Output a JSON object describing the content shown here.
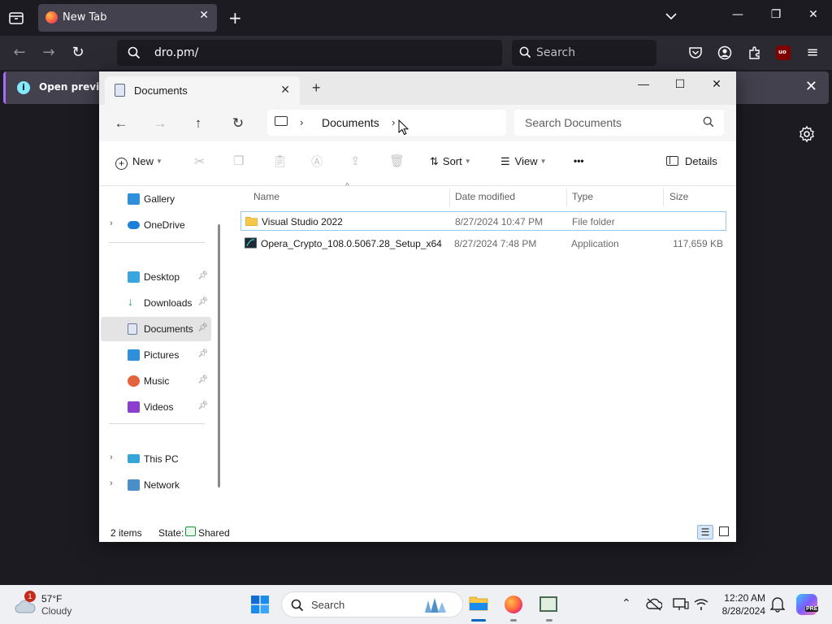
{
  "browser": {
    "tab_title": "New Tab",
    "url": "dro.pm/",
    "search_placeholder": "Search",
    "notification_text": "Open previous"
  },
  "explorer": {
    "tab_title": "Documents",
    "breadcrumb": "Documents",
    "search_placeholder": "Search Documents",
    "commands": {
      "new": "New",
      "sort": "Sort",
      "view": "View",
      "more": "•••",
      "details": "Details"
    },
    "sidebar": [
      {
        "label": "Gallery",
        "icon": "gallery-icon",
        "pinned": false
      },
      {
        "label": "OneDrive",
        "icon": "onedrive-icon",
        "pinned": false
      },
      {
        "label": "Desktop",
        "icon": "desktop-icon",
        "pinned": true
      },
      {
        "label": "Downloads",
        "icon": "downloads-icon",
        "pinned": true
      },
      {
        "label": "Documents",
        "icon": "documents-icon",
        "pinned": true
      },
      {
        "label": "Pictures",
        "icon": "pictures-icon",
        "pinned": true
      },
      {
        "label": "Music",
        "icon": "music-icon",
        "pinned": true
      },
      {
        "label": "Videos",
        "icon": "videos-icon",
        "pinned": true
      },
      {
        "label": "This PC",
        "icon": "this-pc-icon",
        "pinned": false
      },
      {
        "label": "Network",
        "icon": "network-icon",
        "pinned": false
      }
    ],
    "columns": {
      "name": "Name",
      "date": "Date modified",
      "type": "Type",
      "size": "Size"
    },
    "files": [
      {
        "name": "Visual Studio 2022",
        "date": "8/27/2024 10:47 PM",
        "type": "File folder",
        "size": ""
      },
      {
        "name": "Opera_Crypto_108.0.5067.28_Setup_x64",
        "date": "8/27/2024 7:48 PM",
        "type": "Application",
        "size": "117,659 KB"
      }
    ],
    "status": {
      "count": "2 items",
      "state_label": "State:",
      "state_value": "Shared"
    }
  },
  "taskbar": {
    "temperature": "57°F",
    "condition": "Cloudy",
    "weather_badge": "1",
    "search_placeholder": "Search",
    "time": "12:20 AM",
    "date": "8/28/2024"
  },
  "colors": {
    "accent": "#0067c0",
    "selection_border": "#99c9ef",
    "folder": "#f8c84a"
  }
}
